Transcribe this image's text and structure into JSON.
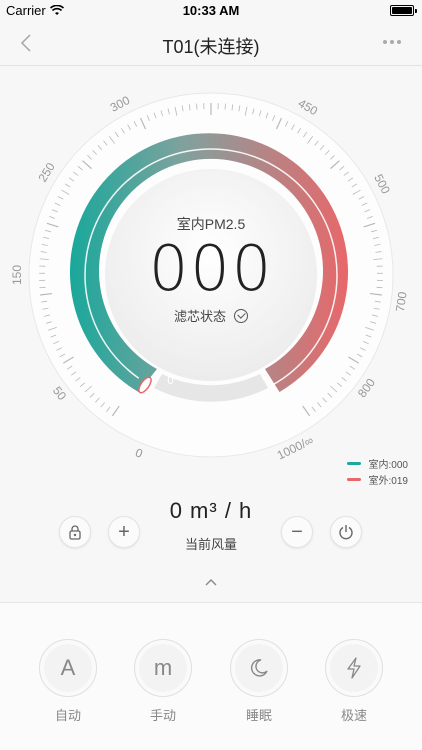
{
  "status_bar": {
    "carrier": "Carrier",
    "time": "10:33 AM"
  },
  "nav": {
    "back_icon": "chevron-left-icon",
    "title": "T01(未连接)",
    "more_icon": "more-icon"
  },
  "gauge": {
    "label": "室内PM2.5",
    "value": "000",
    "filter_status": "滤芯状态",
    "ticks": [
      "0",
      "50",
      "150",
      "250",
      "300",
      "450",
      "500",
      "700",
      "800",
      "1000/∞"
    ],
    "pointer_value": 0,
    "colors": {
      "teal": "#1aa99c",
      "gray": "#a9a9a9",
      "red": "#e8676a",
      "track": "#ececec"
    }
  },
  "legend": [
    {
      "label": "室内:000",
      "color": "#1aa99c"
    },
    {
      "label": "室外:019",
      "color": "#e8676a"
    }
  ],
  "airflow": {
    "value": "0 m³ / h",
    "label": "当前风量"
  },
  "controls": {
    "lock_icon": "lock-icon",
    "plus": "+",
    "minus": "−",
    "power_icon": "power-icon"
  },
  "modes": [
    {
      "label": "自动",
      "icon": "A"
    },
    {
      "label": "手动",
      "icon": "m"
    },
    {
      "label": "睡眠",
      "icon": "moon-icon"
    },
    {
      "label": "极速",
      "icon": "lightning-icon"
    }
  ]
}
